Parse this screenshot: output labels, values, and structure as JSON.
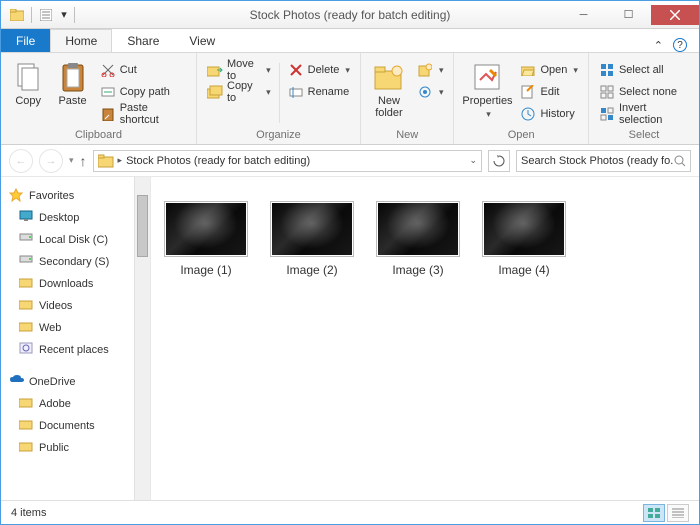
{
  "window": {
    "title": "Stock Photos (ready for batch editing)"
  },
  "tabs": {
    "file": "File",
    "home": "Home",
    "share": "Share",
    "view": "View"
  },
  "ribbon": {
    "clipboard": {
      "label": "Clipboard",
      "copy": "Copy",
      "paste": "Paste",
      "cut": "Cut",
      "copy_path": "Copy path",
      "paste_shortcut": "Paste shortcut"
    },
    "organize": {
      "label": "Organize",
      "move_to": "Move to",
      "copy_to": "Copy to",
      "delete": "Delete",
      "rename": "Rename"
    },
    "new": {
      "label": "New",
      "new_folder": "New folder"
    },
    "open": {
      "label": "Open",
      "properties": "Properties",
      "open": "Open",
      "edit": "Edit",
      "history": "History"
    },
    "select": {
      "label": "Select",
      "select_all": "Select all",
      "select_none": "Select none",
      "invert": "Invert selection"
    }
  },
  "address": {
    "path": "Stock Photos (ready for batch editing)",
    "search_placeholder": "Search Stock Photos (ready fo..."
  },
  "nav": {
    "favorites": "Favorites",
    "desktop": "Desktop",
    "local_c": "Local Disk (C)",
    "secondary_s": "Secondary (S)",
    "downloads": "Downloads",
    "videos": "Videos",
    "web": "Web",
    "recent": "Recent places",
    "onedrive": "OneDrive",
    "adobe": "Adobe",
    "documents": "Documents",
    "public": "Public"
  },
  "items": [
    {
      "label": "Image (1)"
    },
    {
      "label": "Image (2)"
    },
    {
      "label": "Image (3)"
    },
    {
      "label": "Image (4)"
    }
  ],
  "status": {
    "count": "4 items"
  }
}
